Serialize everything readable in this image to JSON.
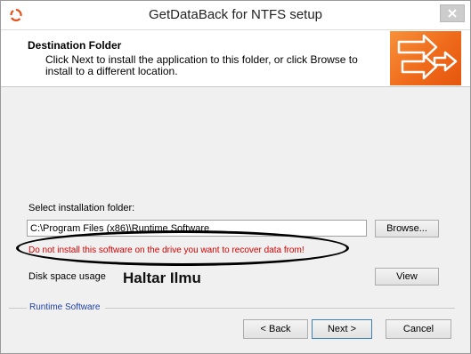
{
  "window": {
    "title": "GetDataBack for NTFS setup"
  },
  "header": {
    "title": "Destination Folder",
    "description": "Click Next to install the application to this folder, or click Browse to install to a different location."
  },
  "folder": {
    "label": "Select installation folder:",
    "path": "C:\\Program Files (x86)\\Runtime Software",
    "browse_label": "Browse..."
  },
  "warning": "Do not install this software on the drive you want to recover data from!",
  "disk": {
    "label": "Disk space usage",
    "view_label": "View"
  },
  "watermark": "Haltar Ilmu",
  "footer": {
    "brand": "Runtime Software",
    "back_label": "< Back",
    "next_label": "Next >",
    "cancel_label": "Cancel"
  },
  "colors": {
    "accent_orange": "#ef6a1a",
    "warning_red": "#d10000",
    "brand_blue": "#1f3fa8"
  }
}
